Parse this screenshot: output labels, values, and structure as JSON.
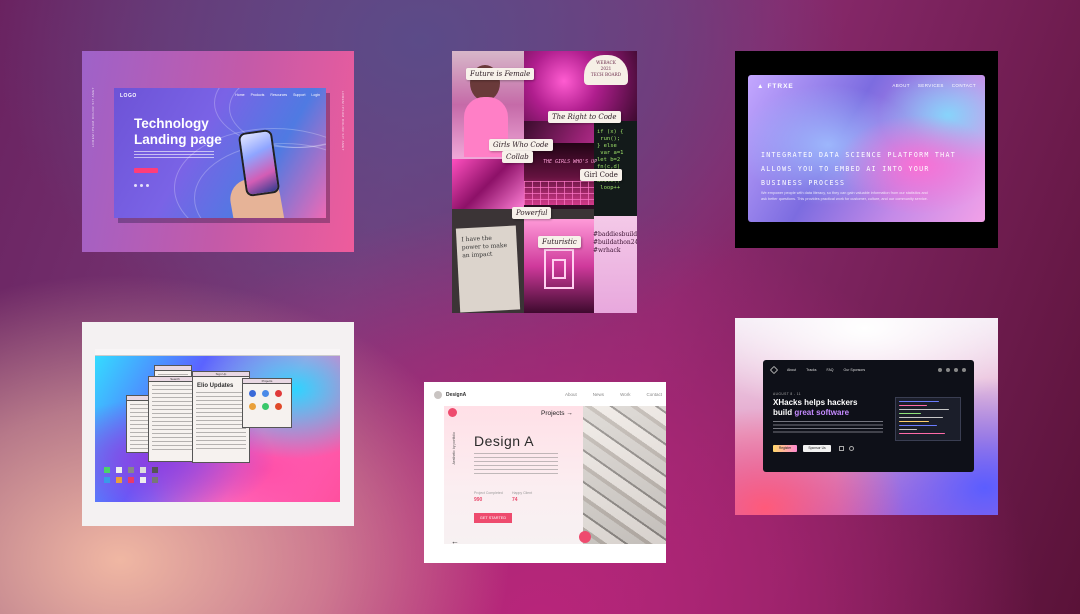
{
  "card1": {
    "logo": "LOGO",
    "nav": [
      "Home",
      "Products",
      "Resources",
      "Support",
      "Login"
    ],
    "title": "Technology Landing page",
    "cta": "READ MORE",
    "side_left": "LOREM IPSUM DOLOR SIT AMET",
    "side_right": "LOREM IPSUM DOLOR SIT AMET"
  },
  "card2": {
    "labels": [
      "Future is Female",
      "The Right to Code",
      "Girls Who Code",
      "Collab",
      "Girl Code",
      "Powerful",
      "Futuristic"
    ],
    "sign": "THE GIRLS WHO'S UP",
    "badge": [
      "WEBACK",
      "2021",
      "TECH BOARD"
    ],
    "note": "I have the power to make an impact",
    "hashtags": [
      "#baddiesbuild",
      "#buildathon24",
      "#wrhack"
    ]
  },
  "card3": {
    "logo": "FTRXE",
    "nav": [
      "ABOUT",
      "SERVICES",
      "CONTACT"
    ],
    "headline": "INTEGRATED DATA SCIENCE PLATFORM THAT ALLOWS YOU TO EMBED AI INTO YOUR BUSINESS PROCESS",
    "body": "We empower people with data literacy, so they can gain valuable information from our statistics and ask better questions. This provides practical work for customer, culture, and our community service."
  },
  "card4": {
    "windows": [
      "Elio Updates",
      "Sign Up",
      "Projects",
      "Search"
    ]
  },
  "card5": {
    "brand": "DesignA",
    "nav": [
      "About",
      "News",
      "Work",
      "Contact"
    ],
    "title": "Design A",
    "projects": "Projects",
    "side": "Aesthetic by portfolio",
    "stats": [
      {
        "label": "Project Completed",
        "value": "990"
      },
      {
        "label": "Happy Client",
        "value": "74"
      }
    ],
    "cta": "GET STARTED"
  },
  "card6": {
    "nav": [
      "About",
      "Tracks",
      "FAQ",
      "Our Sponsors"
    ],
    "kicker": "AUGUST 8 - 11",
    "headline_1": "XHacks helps hackers",
    "headline_2a": "build ",
    "headline_2b": "great software",
    "register": "Register",
    "sponsor": "Sponsor Us"
  }
}
